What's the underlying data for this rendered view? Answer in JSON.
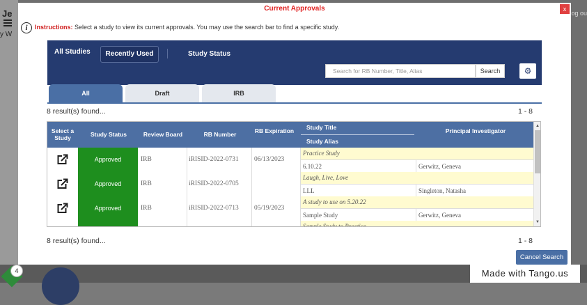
{
  "background": {
    "left_title": "Je",
    "left_text": "y W",
    "right_text": "og ou",
    "step_badge": "4"
  },
  "modal": {
    "title": "Current Approvals",
    "close_label": "x",
    "instructions_label": "Instructions:",
    "instructions_text": " Select a study to view its current approvals. You may use the search bar to find a specific study."
  },
  "nav": {
    "tabs": [
      "All Studies",
      "Recently Used",
      "Study Status"
    ],
    "search": {
      "placeholder": "Search for RB Number, Title, Alias",
      "button": "Search"
    },
    "settings_icon": "gear-icon"
  },
  "subtabs": [
    "All",
    "Draft",
    "IRB"
  ],
  "results": {
    "count_text": "8 result(s) found...",
    "range_text": "1 - 8"
  },
  "table": {
    "headers": {
      "select": "Select a Study",
      "status": "Study Status",
      "review_board": "Review Board",
      "rb_number": "RB Number",
      "rb_expiration": "RB Expiration",
      "study_title": "Study Title",
      "study_alias": "Study Alias",
      "pi": "Principal Investigator"
    },
    "rows": [
      {
        "status": "Approved",
        "review_board": "IRB",
        "rb_number": "iRISID-2022-0731",
        "expiration": "06/13/2023",
        "title": "Practice Study",
        "alias": "6.10.22",
        "pi": "Gerwitz, Geneva"
      },
      {
        "status": "Approved",
        "review_board": "IRB",
        "rb_number": "iRISID-2022-0705",
        "expiration": "",
        "title": "Laugh, Live, Love",
        "alias": "LLL",
        "pi": "Singleton, Natasha"
      },
      {
        "status": "Approved",
        "review_board": "IRB",
        "rb_number": "iRISID-2022-0713",
        "expiration": "05/19/2023",
        "title": "A study to use on 5.20.22",
        "alias": "Sample Study",
        "pi": "Gerwitz, Geneva"
      },
      {
        "status": "",
        "review_board": "",
        "rb_number": "",
        "expiration": "",
        "title": "Sample Study to Practice",
        "alias": "",
        "pi": ""
      }
    ]
  },
  "footer": {
    "cancel_button": "Cancel Search"
  },
  "watermark": "Made with Tango.us",
  "colors": {
    "navbar": "#253b70",
    "approved": "#1e8e1e",
    "title_title": "#e02020",
    "header": "#4d6fa3"
  }
}
